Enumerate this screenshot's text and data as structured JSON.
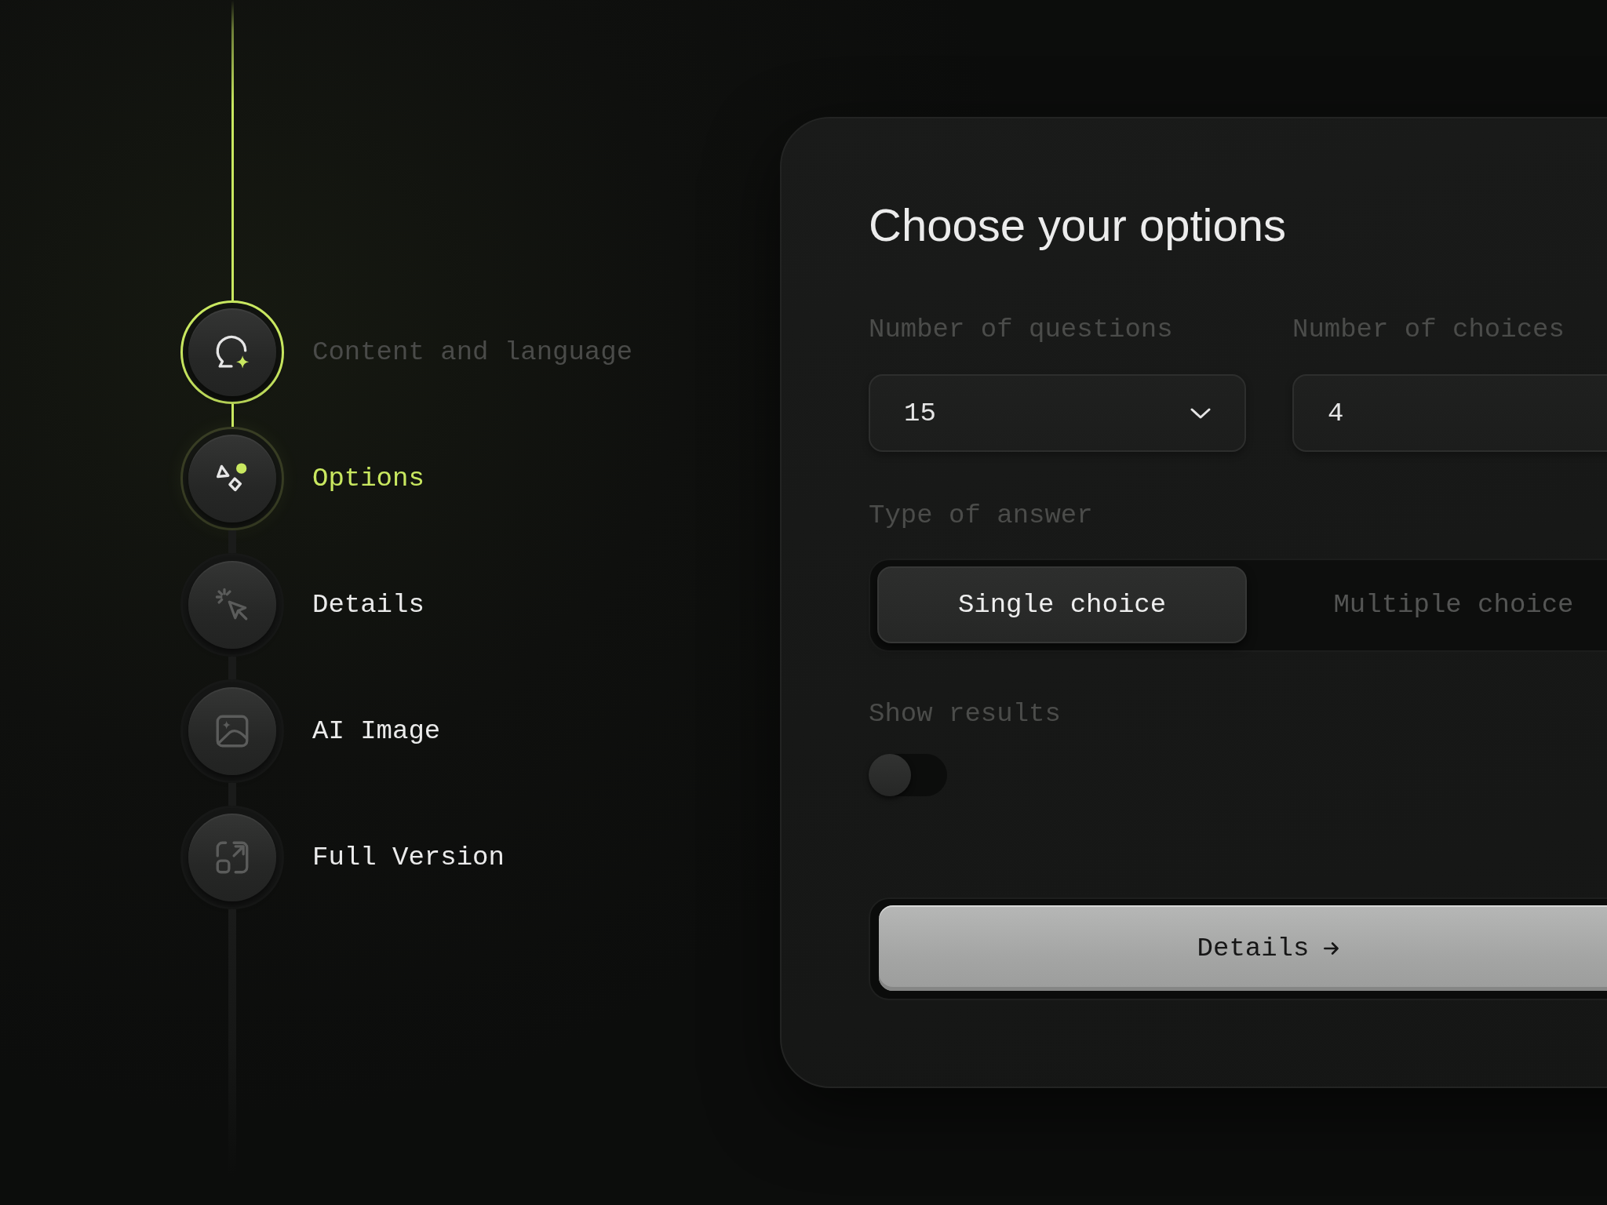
{
  "steps": [
    {
      "label": "Content and language",
      "completed": true,
      "selected": false
    },
    {
      "label": "Options",
      "completed": false,
      "selected": true
    },
    {
      "label": "Details",
      "completed": false,
      "selected": false
    },
    {
      "label": "AI Image",
      "completed": false,
      "selected": false
    },
    {
      "label": "Full Version",
      "completed": false,
      "selected": false
    }
  ],
  "panel": {
    "title": "Choose your options",
    "fields": [
      {
        "label": "Number of questions",
        "value": "15",
        "kind": "select"
      },
      {
        "label": "Number of choices",
        "value": "4",
        "kind": "input"
      }
    ],
    "answer_type": {
      "label": "Type of answer",
      "options": [
        {
          "label": "Single choice",
          "selected": true
        },
        {
          "label": "Multiple choice",
          "selected": false
        }
      ]
    },
    "show_results": {
      "label": "Show results",
      "on": false
    },
    "submit_button": {
      "label": "Details"
    }
  }
}
